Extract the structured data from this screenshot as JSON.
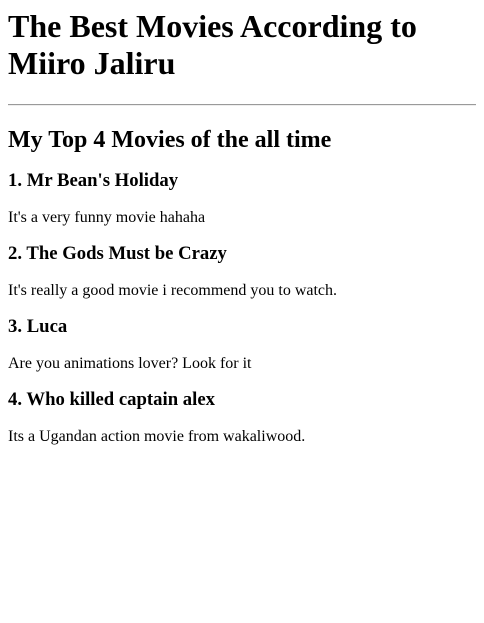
{
  "page": {
    "title": "The Best Movies According to Miiro Jaliru",
    "subtitle": "My Top 4 Movies of the all time"
  },
  "movies": [
    {
      "heading": "1. Mr Bean's Holiday",
      "description": "It's a very funny movie hahaha"
    },
    {
      "heading": "2. The Gods Must be Crazy",
      "description": "It's really a good movie i recommend you to watch."
    },
    {
      "heading": "3. Luca",
      "description": "Are you animations lover? Look for it"
    },
    {
      "heading": "4. Who killed captain alex",
      "description": "Its a Ugandan action movie from wakaliwood."
    }
  ]
}
